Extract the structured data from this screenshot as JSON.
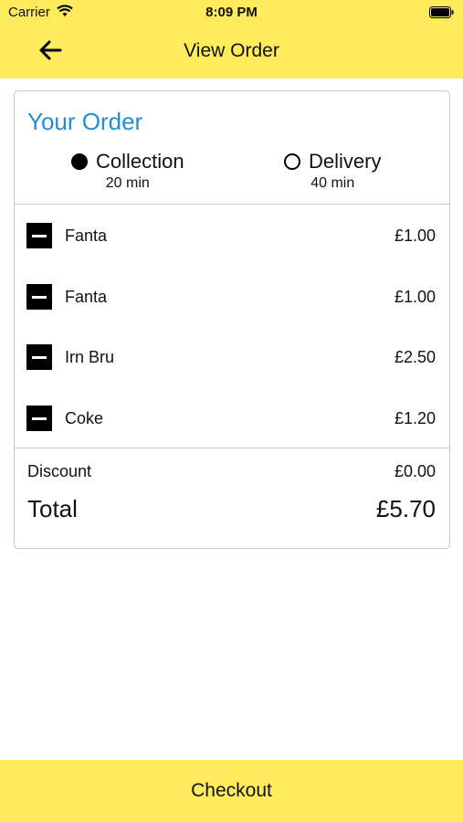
{
  "status_bar": {
    "carrier": "Carrier",
    "time": "8:09 PM"
  },
  "nav": {
    "title": "View Order",
    "back_icon": "arrow-left-icon"
  },
  "order": {
    "title": "Your Order",
    "options": [
      {
        "label": "Collection",
        "time": "20 min",
        "selected": true
      },
      {
        "label": "Delivery",
        "time": "40 min",
        "selected": false
      }
    ],
    "items": [
      {
        "name": "Fanta",
        "price": "£1.00"
      },
      {
        "name": "Fanta",
        "price": "£1.00"
      },
      {
        "name": "Irn Bru",
        "price": "£2.50"
      },
      {
        "name": "Coke",
        "price": "£1.20"
      }
    ],
    "discount_label": "Discount",
    "discount_value": "£0.00",
    "total_label": "Total",
    "total_value": "£5.70"
  },
  "checkout_label": "Checkout",
  "colors": {
    "accent_yellow": "#ffeb5c",
    "title_blue": "#1e8fd6"
  }
}
